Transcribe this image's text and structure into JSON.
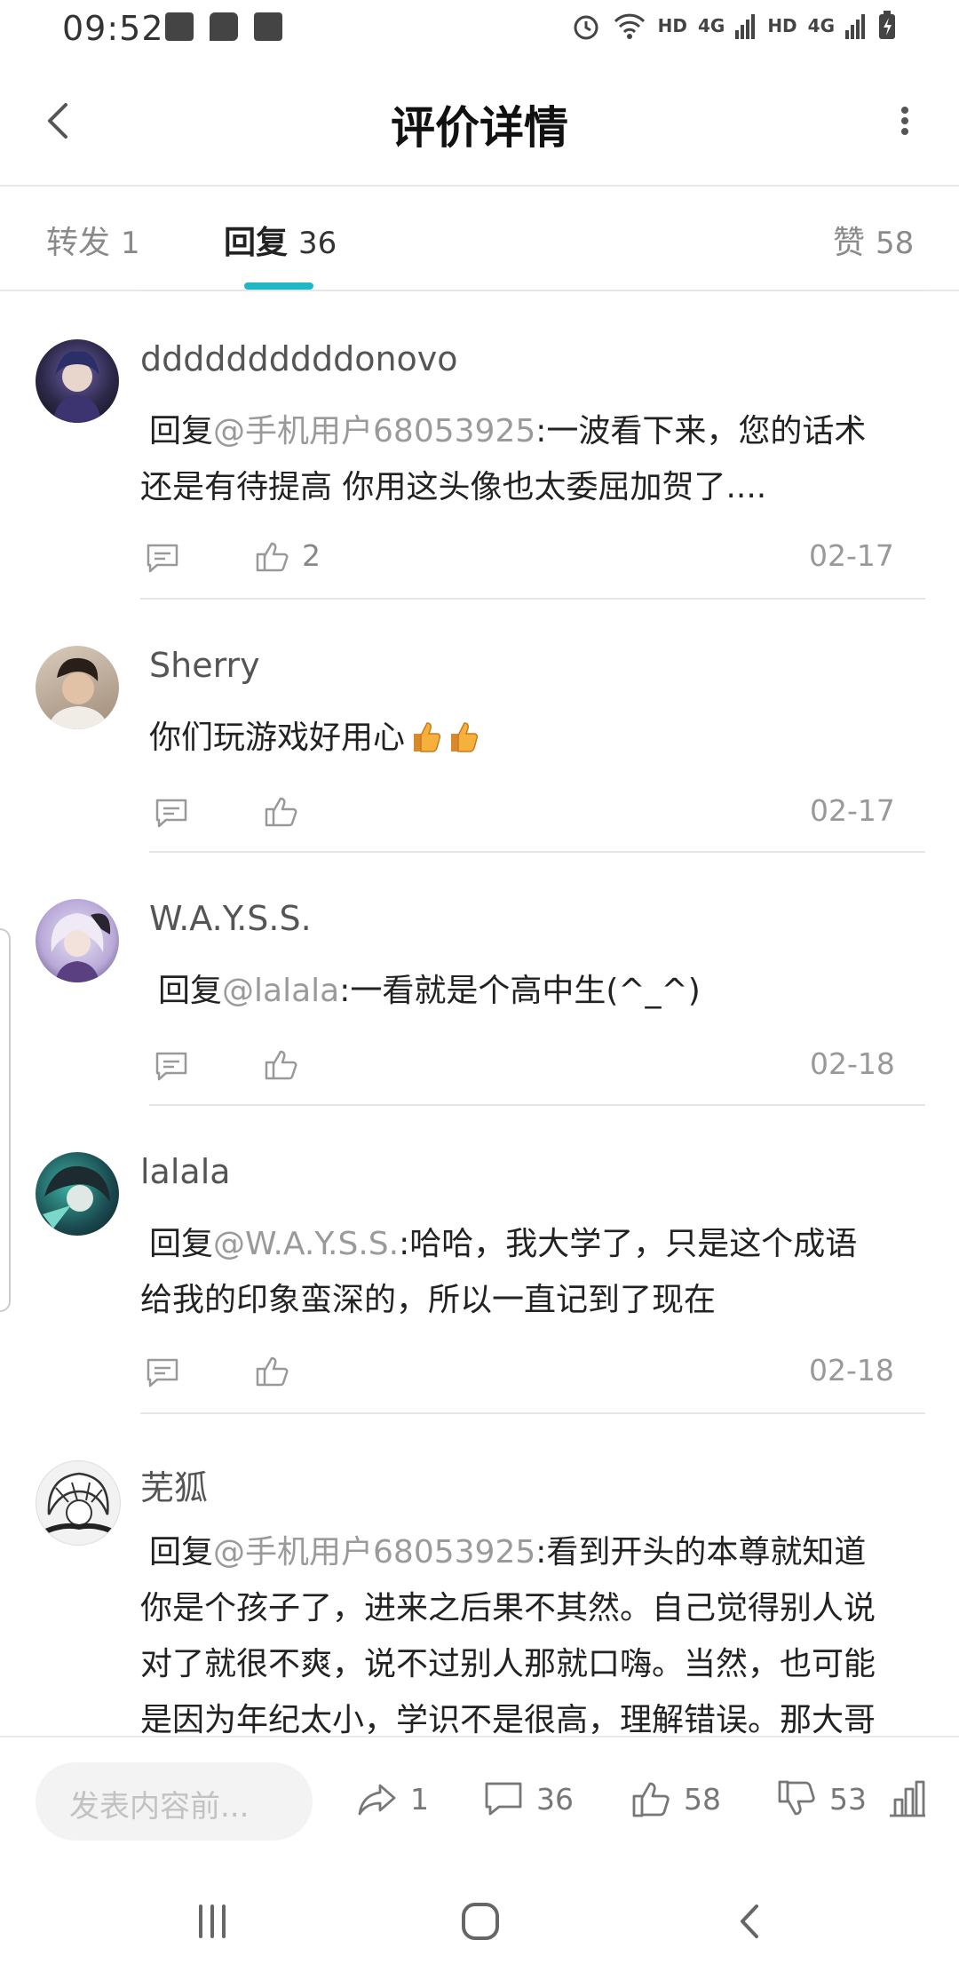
{
  "status_bar": {
    "time": "09:52",
    "right_labels": [
      "HD",
      "4G",
      "HD",
      "4G"
    ]
  },
  "app_bar": {
    "title": "评价详情"
  },
  "tabs": [
    {
      "label": "转发",
      "count": "1"
    },
    {
      "label": "回复",
      "count": "36"
    },
    {
      "label": "赞",
      "count": "58"
    }
  ],
  "comments": [
    {
      "username": "ddddddddddonovo",
      "reply_prefix": "回复",
      "mention": "@手机用户68053925",
      "text_lines": [
        ":一波看下来，您的话术",
        "还是有待提高 你用这头像也太委屈加贺了...."
      ],
      "likes": "2",
      "date": "02-17"
    },
    {
      "username": "Sherry",
      "text_lines": [
        "你们玩游戏好用心"
      ],
      "likes": "",
      "date": "02-17"
    },
    {
      "username": "W.A.Y.S.S.",
      "reply_prefix": "回复",
      "mention": "@lalala",
      "text_lines": [
        ":一看就是个高中生(^_^)"
      ],
      "likes": "",
      "date": "02-18"
    },
    {
      "username": "lalala",
      "reply_prefix": "回复",
      "mention": "@W.A.Y.S.S.",
      "text_lines": [
        ":哈哈，我大学了，只是这个成语",
        "给我的印象蛮深的，所以一直记到了现在"
      ],
      "likes": "",
      "date": "02-18"
    },
    {
      "username": "芜狐",
      "reply_prefix": "回复",
      "mention": "@手机用户68053925",
      "text_lines": [
        ":看到开头的本尊就知道",
        "你是个孩子了，进来之后果不其然。自己觉得别人说",
        "对了就很不爽，说不过别人那就口嗨。当然，也可能",
        "是因为年纪太小，学识不是很高，理解错误。那大哥"
      ]
    }
  ],
  "bottom_bar": {
    "composer_placeholder": "发表内容前...",
    "share_count": "1",
    "comment_count": "36",
    "like_count": "58",
    "dislike_count": "53"
  },
  "colors": {
    "accent": "#1fb8c4",
    "mention": "#9a9a9a",
    "muted": "#888888"
  },
  "icons": [
    "back-arrow-icon",
    "more-vertical-icon",
    "reply-icon",
    "thumb-up-icon",
    "share-icon",
    "comment-icon",
    "thumb-down-icon",
    "stats-icon",
    "recents-icon",
    "home-icon",
    "nav-back-icon"
  ]
}
